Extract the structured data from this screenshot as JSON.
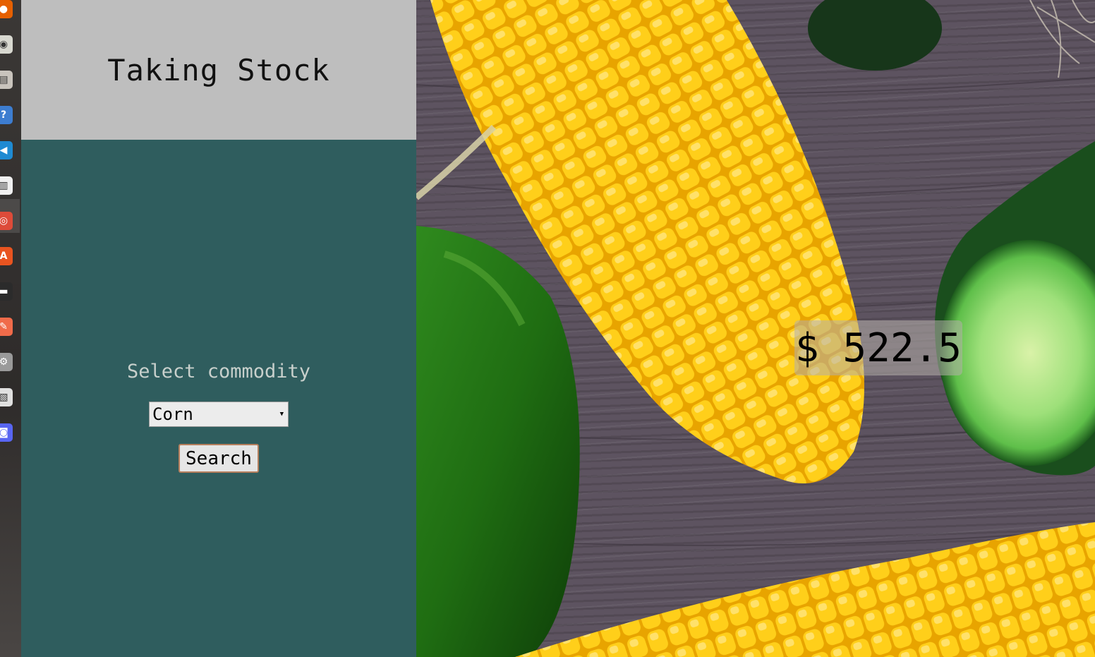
{
  "header": {
    "title": "Taking Stock"
  },
  "form": {
    "label": "Select commodity",
    "selected": "Corn",
    "search_label": "Search"
  },
  "result": {
    "price": "$ 522.5"
  },
  "dock": [
    {
      "name": "firefox-icon",
      "color": "#e66000"
    },
    {
      "name": "rhythmbox-icon",
      "color": "#d8d8d0"
    },
    {
      "name": "files-icon",
      "color": "#c9c4bd"
    },
    {
      "name": "help-icon",
      "color": "#3d7dd0"
    },
    {
      "name": "vscode-icon",
      "color": "#1f8ad2"
    },
    {
      "name": "writer-icon",
      "color": "#f0f0f0"
    },
    {
      "name": "chrome-icon",
      "color": "#dd4b39"
    },
    {
      "name": "software-center-icon",
      "color": "#e95420"
    },
    {
      "name": "terminal-icon",
      "color": "#2b2b2b"
    },
    {
      "name": "editor-icon",
      "color": "#f06b4a"
    },
    {
      "name": "settings-icon",
      "color": "#9a9a9a"
    },
    {
      "name": "document-viewer-icon",
      "color": "#e0e0e0"
    },
    {
      "name": "discord-icon",
      "color": "#5865f2"
    }
  ],
  "colors": {
    "header_bg": "#bebebe",
    "panel_bg": "#2f5d5e"
  }
}
